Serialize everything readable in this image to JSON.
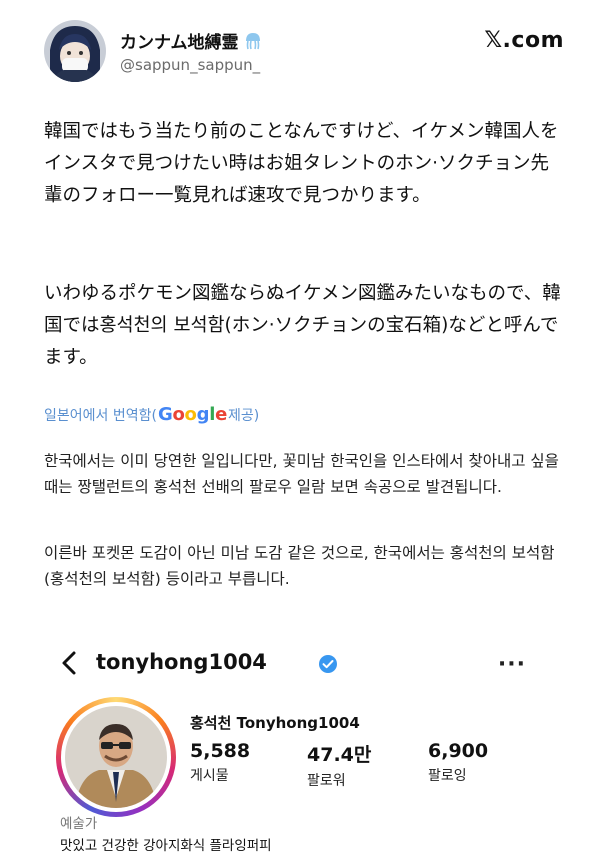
{
  "tweet": {
    "user_name": "カンナム地縛霊",
    "user_handle": "@sappun_sappun_",
    "site_logo": "𝕏.com",
    "paragraph_1": "韓国ではもう当たり前のことなんですけど、イケメン韓国人をインスタで見つけたい時はお姐タレントのホン·ソクチョン先輩のフォロー一覧見れば速攻で見つかります。",
    "paragraph_2": "いわゆるポケモン図鑑ならぬイケメン図鑑みたいなもので、韓国では홍석천의 보석함(ホン·ソクチョンの宝石箱)などと呼んでます。",
    "icons": {
      "avatar": "user-avatar",
      "badge": "jellyfish-emoji-icon"
    }
  },
  "translation": {
    "prefix": "일본어에서 번역함(",
    "google": [
      "G",
      "o",
      "o",
      "g",
      "l",
      "e"
    ],
    "suffix": " 제공)",
    "paragraph_1": "한국에서는 이미 당연한 일입니다만, 꽃미남 한국인을 인스타에서 찾아내고 싶을 때는 짱탤런트의 홍석천 선배의 팔로우 일람 보면 속공으로 발견됩니다.",
    "paragraph_2": "이른바 포켓몬 도감이 아닌 미남 도감 같은 것으로, 한국에서는 홍석천의 보석함(홍석천의 보석함) 등이라고 부릅니다."
  },
  "instagram": {
    "username": "tonyhong1004",
    "more": "···",
    "display_name": "홍석천 Tonyhong1004",
    "stats": [
      {
        "value": "5,588",
        "label": "게시물"
      },
      {
        "value": "47.4만",
        "label": "팔로워"
      },
      {
        "value": "6,900",
        "label": "팔로잉"
      }
    ],
    "bio_category": "예술가",
    "bio_text": "맛있고 건강한 강아지화식 플라잉퍼피",
    "icons": {
      "back": "chevron-left-icon",
      "verified": "verified-badge-icon",
      "more": "more-options-icon"
    }
  },
  "colors": {
    "translate_link": "#5a8fcf",
    "verified_blue": "#3897f0",
    "google_blue": "#4285F4",
    "google_red": "#EA4335",
    "google_yellow": "#FBBC05",
    "google_green": "#34A853"
  }
}
